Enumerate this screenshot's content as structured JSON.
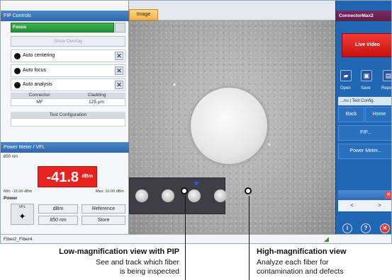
{
  "fip_controls": {
    "title": "FIP Controls",
    "focus_label": "Focus",
    "show_overlay": "Show Overlay",
    "options": [
      {
        "label": "Auto centering",
        "icon": "close-icon"
      },
      {
        "label": "Auto focus",
        "icon": "close-icon"
      },
      {
        "label": "Auto analysis",
        "icon": "close-icon"
      }
    ],
    "connector_header": "Connector",
    "cladding_header": "Cladding",
    "connector_value": "MF",
    "cladding_value": "125 µm",
    "test_config_label": "Test Configuration"
  },
  "power_meter": {
    "title": "Power Meter / VFL",
    "wavelength_top": "850 nm",
    "reading": "-41.8",
    "unit": "dBm",
    "min_label": "Min: -15.00 dBm",
    "max_label": "Max: 10.00 dBm",
    "power_label": "Power",
    "vfl_label": "VFL",
    "buttons": {
      "dbm": "dBm",
      "reference": "Reference",
      "wavelength": "850 nm",
      "store": "Store"
    }
  },
  "image_view": {
    "tab_label": "Image"
  },
  "right_panel": {
    "title": "ConnectorMax2",
    "live_video": "Live Video",
    "open": "Open",
    "save": "Save",
    "report": "Repo",
    "config_bar": "...nu | Test Config.",
    "back": "Back",
    "home": "Home",
    "fip": "FIP...",
    "power_meter": "Power Meter...",
    "nav_prev": "<",
    "nav_next": ">"
  },
  "status_bar": {
    "text": "Fiber2_Fiber4"
  },
  "callouts": {
    "left_title": "Low-magnification view with PIP",
    "left_line1": "See and track which fiber",
    "left_line2": "is being inspected",
    "right_title": "High-magnification view",
    "right_line1": "Analyze each fiber for",
    "right_line2": "contamination and defects"
  },
  "colors": {
    "focus_green": "#2aa140",
    "reading_red": "#e8221f",
    "live_video_red": "#e02a25",
    "panel_blue": "#1f66b3",
    "tab_orange": "#f4b24c"
  }
}
